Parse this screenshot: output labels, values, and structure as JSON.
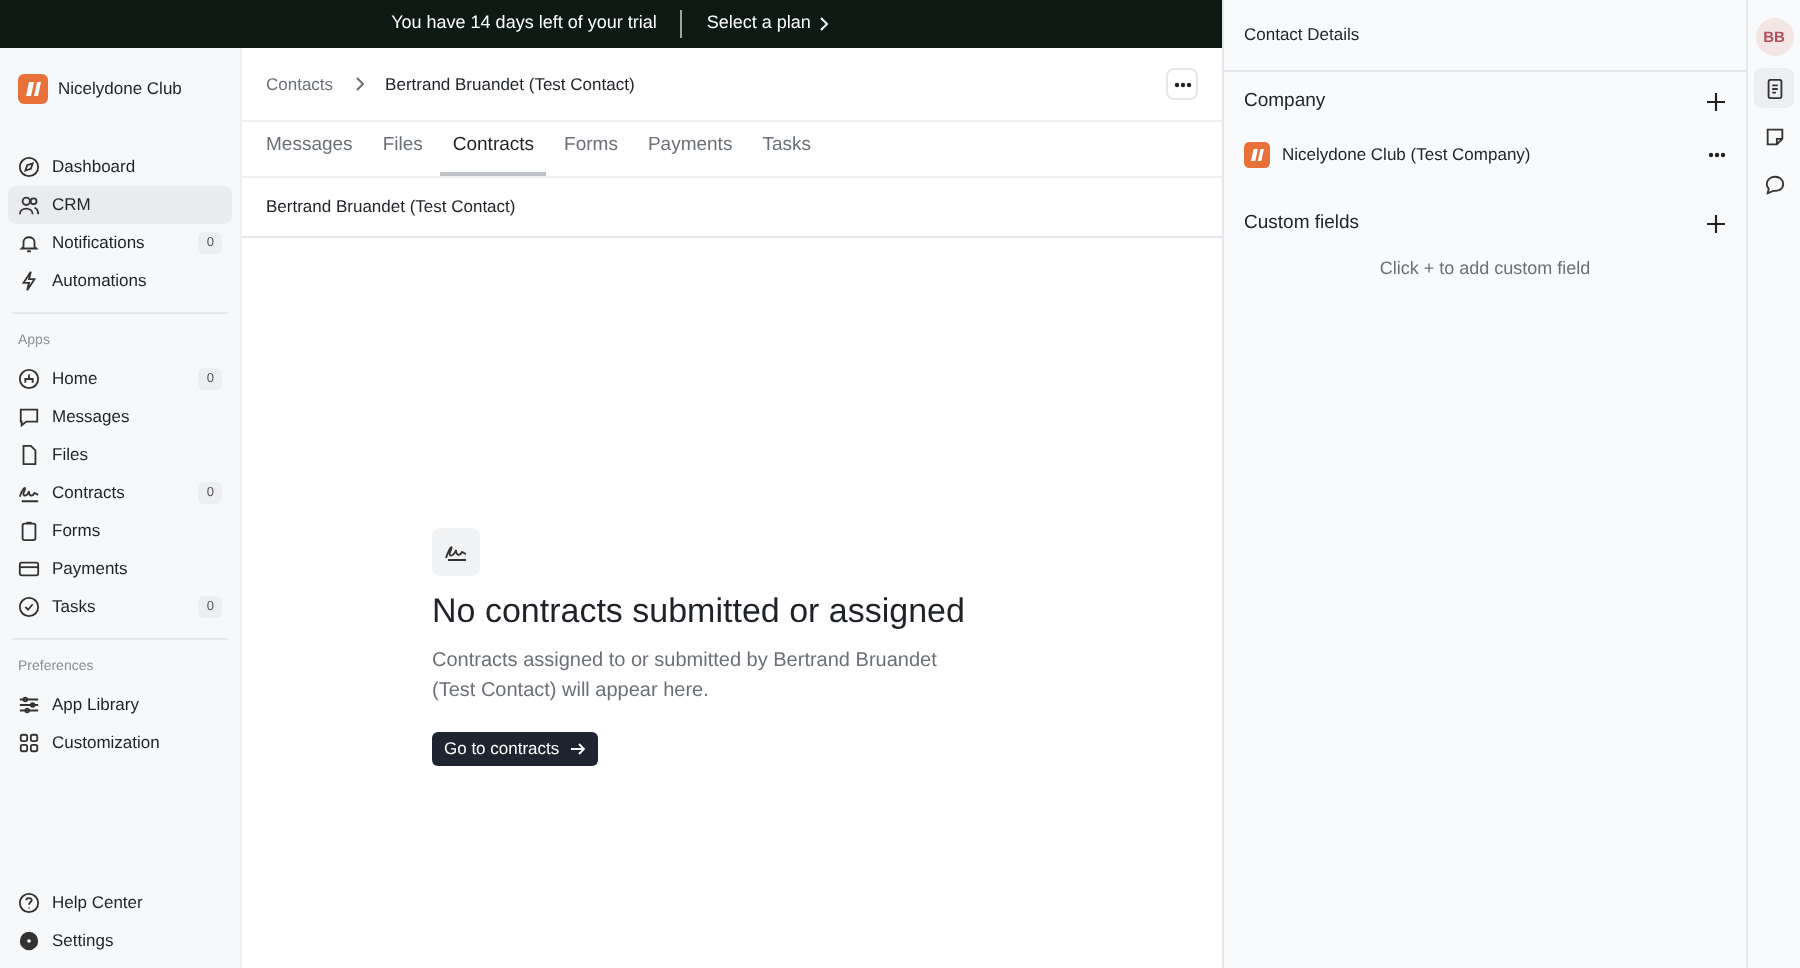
{
  "banner": {
    "message": "You have 14 days left of your trial",
    "action": "Select a plan"
  },
  "workspace": {
    "name": "Nicelydone Club"
  },
  "sidebar": {
    "sections": [
      {
        "items": [
          {
            "label": "Dashboard",
            "selected": false
          },
          {
            "label": "CRM",
            "selected": true
          },
          {
            "label": "Notifications",
            "badge": "0",
            "selected": false
          },
          {
            "label": "Automations",
            "selected": false
          }
        ]
      },
      {
        "heading": "Apps",
        "items": [
          {
            "label": "Home",
            "badge": "0",
            "selected": false
          },
          {
            "label": "Messages",
            "selected": false
          },
          {
            "label": "Files",
            "selected": false
          },
          {
            "label": "Contracts",
            "badge": "0",
            "selected": false
          },
          {
            "label": "Forms",
            "selected": false
          },
          {
            "label": "Payments",
            "selected": false
          },
          {
            "label": "Tasks",
            "badge": "0",
            "selected": false
          }
        ]
      },
      {
        "heading": "Preferences",
        "items": [
          {
            "label": "App Library",
            "selected": false
          },
          {
            "label": "Customization",
            "selected": false
          }
        ]
      }
    ],
    "footer": [
      {
        "label": "Help Center"
      },
      {
        "label": "Settings"
      }
    ]
  },
  "breadcrumb": [
    "Contacts",
    "Bertrand Bruandet (Test Contact)"
  ],
  "tabs": [
    {
      "label": "Messages",
      "selected": false
    },
    {
      "label": "Files",
      "selected": false
    },
    {
      "label": "Contracts",
      "selected": true
    },
    {
      "label": "Forms",
      "selected": false
    },
    {
      "label": "Payments",
      "selected": false
    },
    {
      "label": "Tasks",
      "selected": false
    }
  ],
  "contact_bar": {
    "name": "Bertrand Bruandet (Test Contact)"
  },
  "empty_state": {
    "title": "No contracts submitted or assigned",
    "description": "Contracts assigned to or submitted by Bertrand Bruandet (Test Contact) will appear here.",
    "button": "Go to contracts"
  },
  "details": {
    "title": "Contact Details",
    "company_heading": "Company",
    "company": "Nicelydone Club (Test Company)",
    "custom_fields_heading": "Custom fields",
    "custom_fields_hint": "Click + to add custom field"
  },
  "rail": {
    "avatar": "BB",
    "items": [
      {
        "selected": true
      },
      {
        "selected": false
      },
      {
        "selected": false
      }
    ]
  }
}
